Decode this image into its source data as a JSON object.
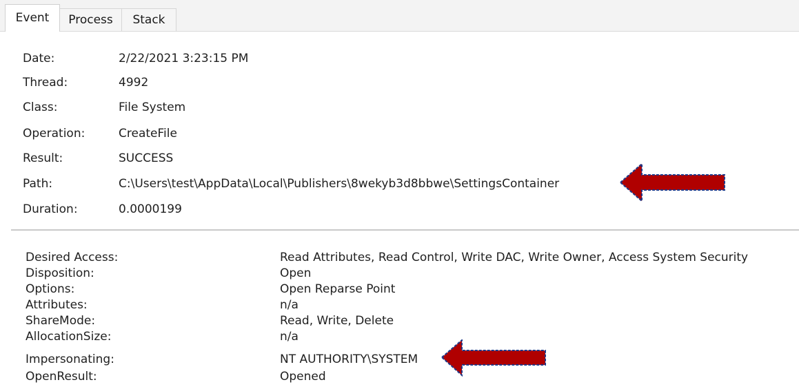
{
  "tabs": [
    {
      "label": "Event",
      "active": true
    },
    {
      "label": "Process",
      "active": false
    },
    {
      "label": "Stack",
      "active": false
    }
  ],
  "event_fields": [
    {
      "label": "Date:",
      "value": "2/22/2021 3:23:15 PM"
    },
    {
      "label": "Thread:",
      "value": "4992"
    },
    {
      "label": "Class:",
      "value": "File System"
    },
    {
      "label": "Operation:",
      "value": "CreateFile"
    },
    {
      "label": "Result:",
      "value": "SUCCESS"
    },
    {
      "label": "Path:",
      "value": "C:\\Users\\test\\AppData\\Local\\Publishers\\8wekyb3d8bbwe\\SettingsContainer"
    },
    {
      "label": "Duration:",
      "value": "0.0000199"
    }
  ],
  "detail_fields": [
    {
      "label": "Desired Access:",
      "value": "Read Attributes, Read Control, Write DAC, Write Owner, Access System Security"
    },
    {
      "label": "Disposition:",
      "value": "Open"
    },
    {
      "label": "Options:",
      "value": "Open Reparse Point"
    },
    {
      "label": "Attributes:",
      "value": "n/a"
    },
    {
      "label": "ShareMode:",
      "value": "Read, Write, Delete"
    },
    {
      "label": "AllocationSize:",
      "value": "n/a"
    },
    {
      "label": "Impersonating:",
      "value": "NT AUTHORITY\\SYSTEM"
    },
    {
      "label": "OpenResult:",
      "value": "Opened"
    }
  ],
  "annotations": {
    "arrow_color": "#b00000",
    "arrow_outline": "#1e3a8a",
    "arrow_icon": "left-arrow-icon"
  }
}
